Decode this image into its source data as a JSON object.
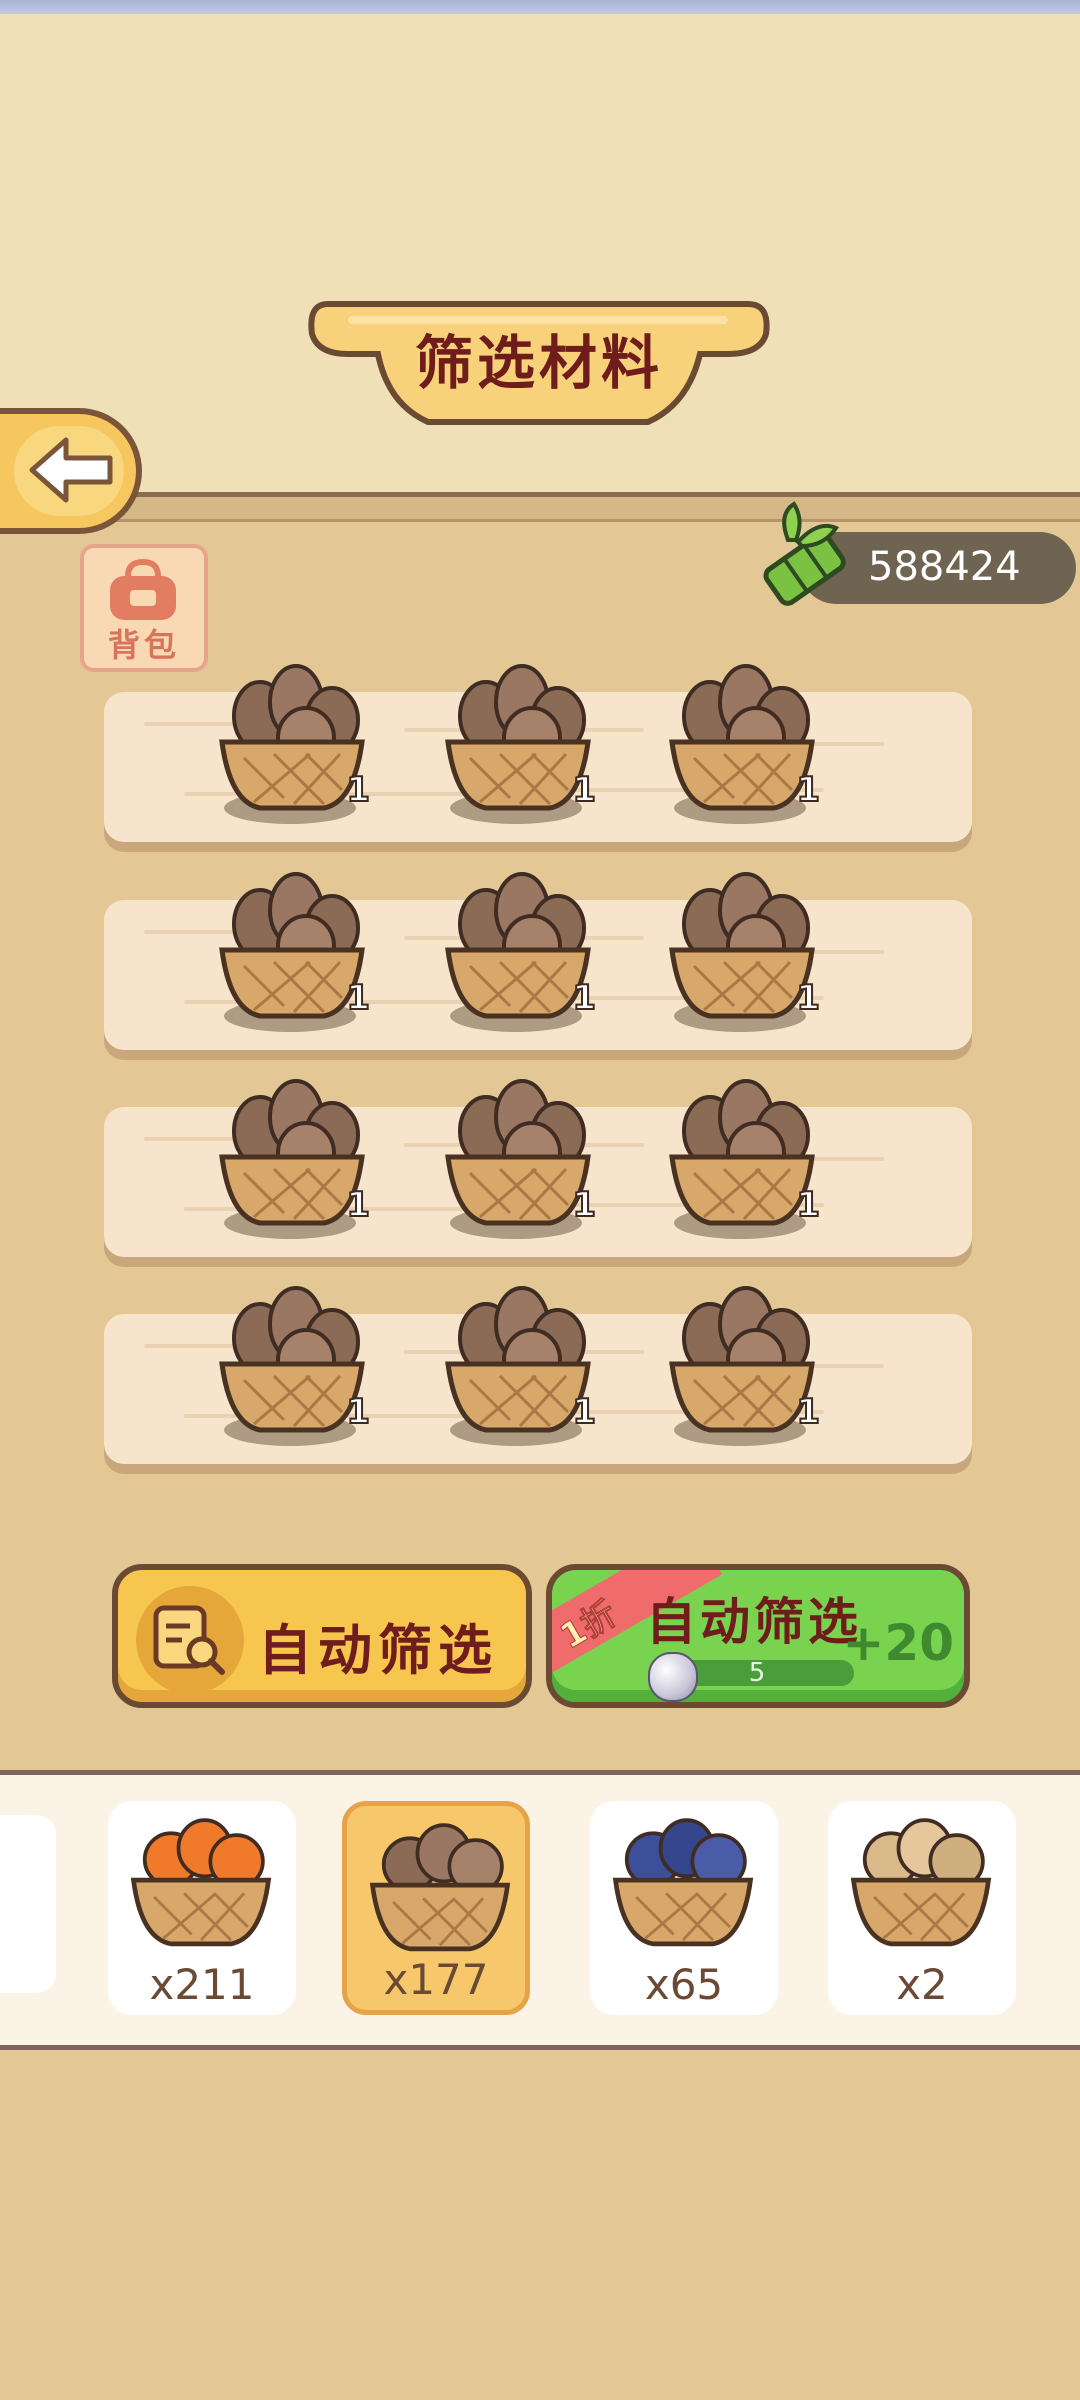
{
  "header": {
    "title": "筛选材料",
    "back_label": "back",
    "backpack_label": "背包"
  },
  "currency": {
    "icon": "bamboo-icon",
    "value": "588424"
  },
  "shelves": [
    {
      "items": [
        {
          "count": "1"
        },
        {
          "count": "1"
        },
        {
          "count": "1"
        }
      ]
    },
    {
      "items": [
        {
          "count": "1"
        },
        {
          "count": "1"
        },
        {
          "count": "1"
        }
      ]
    },
    {
      "items": [
        {
          "count": "1"
        },
        {
          "count": "1"
        },
        {
          "count": "1"
        }
      ]
    },
    {
      "items": [
        {
          "count": "1"
        },
        {
          "count": "1"
        },
        {
          "count": "1"
        }
      ]
    }
  ],
  "actions": {
    "auto_filter_label": "自动筛选",
    "auto_filter2_label": "自动筛选",
    "discount_badge": "1折",
    "pearl_cost": "5",
    "bonus": "+20"
  },
  "inventory": [
    {
      "item": "carrot-basket",
      "qty": "x211",
      "selected": false
    },
    {
      "item": "taro-basket",
      "qty": "x177",
      "selected": true
    },
    {
      "item": "blueberry-basket",
      "qty": "x65",
      "selected": false
    },
    {
      "item": "potato-basket",
      "qty": "x2",
      "selected": false
    }
  ],
  "colors": {
    "background": "#e3c795",
    "title_text": "#6e1c1c",
    "yellow_button": "#f6c64e",
    "green_button": "#79d34f",
    "selected_slot": "#f6c86b"
  }
}
